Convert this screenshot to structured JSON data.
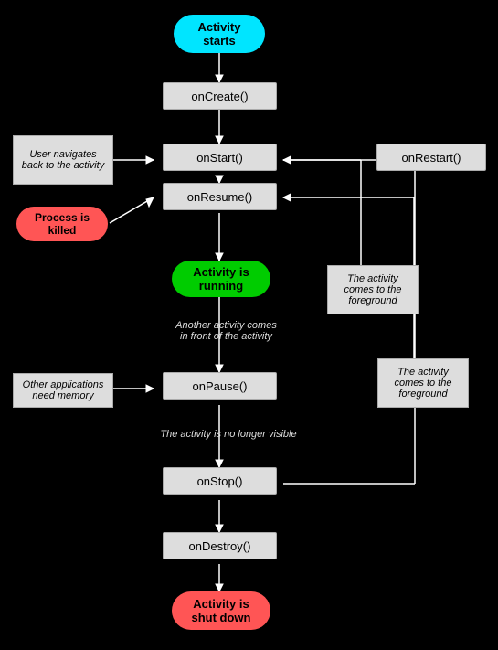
{
  "nodes": {
    "activity_starts": {
      "label": "Activity\nstarts",
      "color": "#00e5ff"
    },
    "on_create": {
      "label": "onCreate()"
    },
    "on_start": {
      "label": "onStart()"
    },
    "on_restart": {
      "label": "onRestart()"
    },
    "on_resume": {
      "label": "onResume()"
    },
    "activity_running": {
      "label": "Activity is\nrunning",
      "color": "#00cc00"
    },
    "on_pause": {
      "label": "onPause()"
    },
    "on_stop": {
      "label": "onStop()"
    },
    "on_destroy": {
      "label": "onDestroy()"
    },
    "activity_shutdown": {
      "label": "Activity is\nshut down",
      "color": "#ff5555"
    },
    "process_killed": {
      "label": "Process is\nkilled",
      "color": "#ff5555"
    },
    "user_navigates": {
      "label": "User navigates\nback to the\nactivity"
    },
    "another_activity": {
      "label": "Another activity comes\nin front of the activity"
    },
    "not_visible": {
      "label": "The activity is no longer visible"
    },
    "other_apps": {
      "label": "Other applications\nneed memory"
    },
    "foreground1": {
      "label": "The activity\ncomes to the\nforeground"
    },
    "foreground2": {
      "label": "The activity\ncomes to the\nforeground"
    }
  }
}
